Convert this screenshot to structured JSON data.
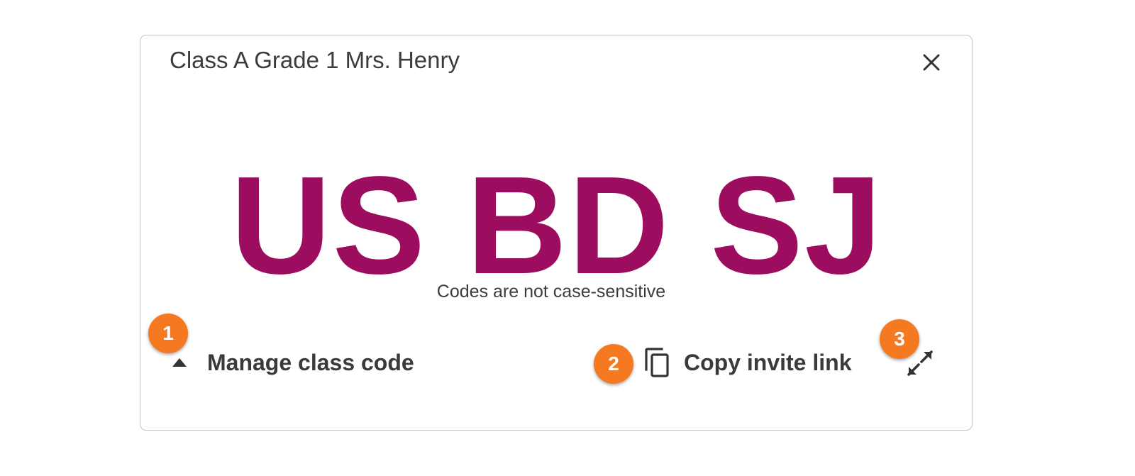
{
  "dialog": {
    "title": "Class A Grade 1 Mrs. Henry",
    "class_code": "US BD SJ",
    "case_note": "Codes are not case-sensitive",
    "manage_label": "Manage class code",
    "copy_label": "Copy invite link"
  },
  "callouts": [
    "1",
    "2",
    "3"
  ],
  "icons": {
    "close": "close-icon",
    "manage_toggle": "caret-up-icon",
    "copy": "copy-icon",
    "fullscreen": "expand-icon"
  },
  "colors": {
    "class_code": "#9c0d60",
    "callout": "#f47920",
    "text": "#3c3c3c",
    "border": "#c6c6c6"
  }
}
